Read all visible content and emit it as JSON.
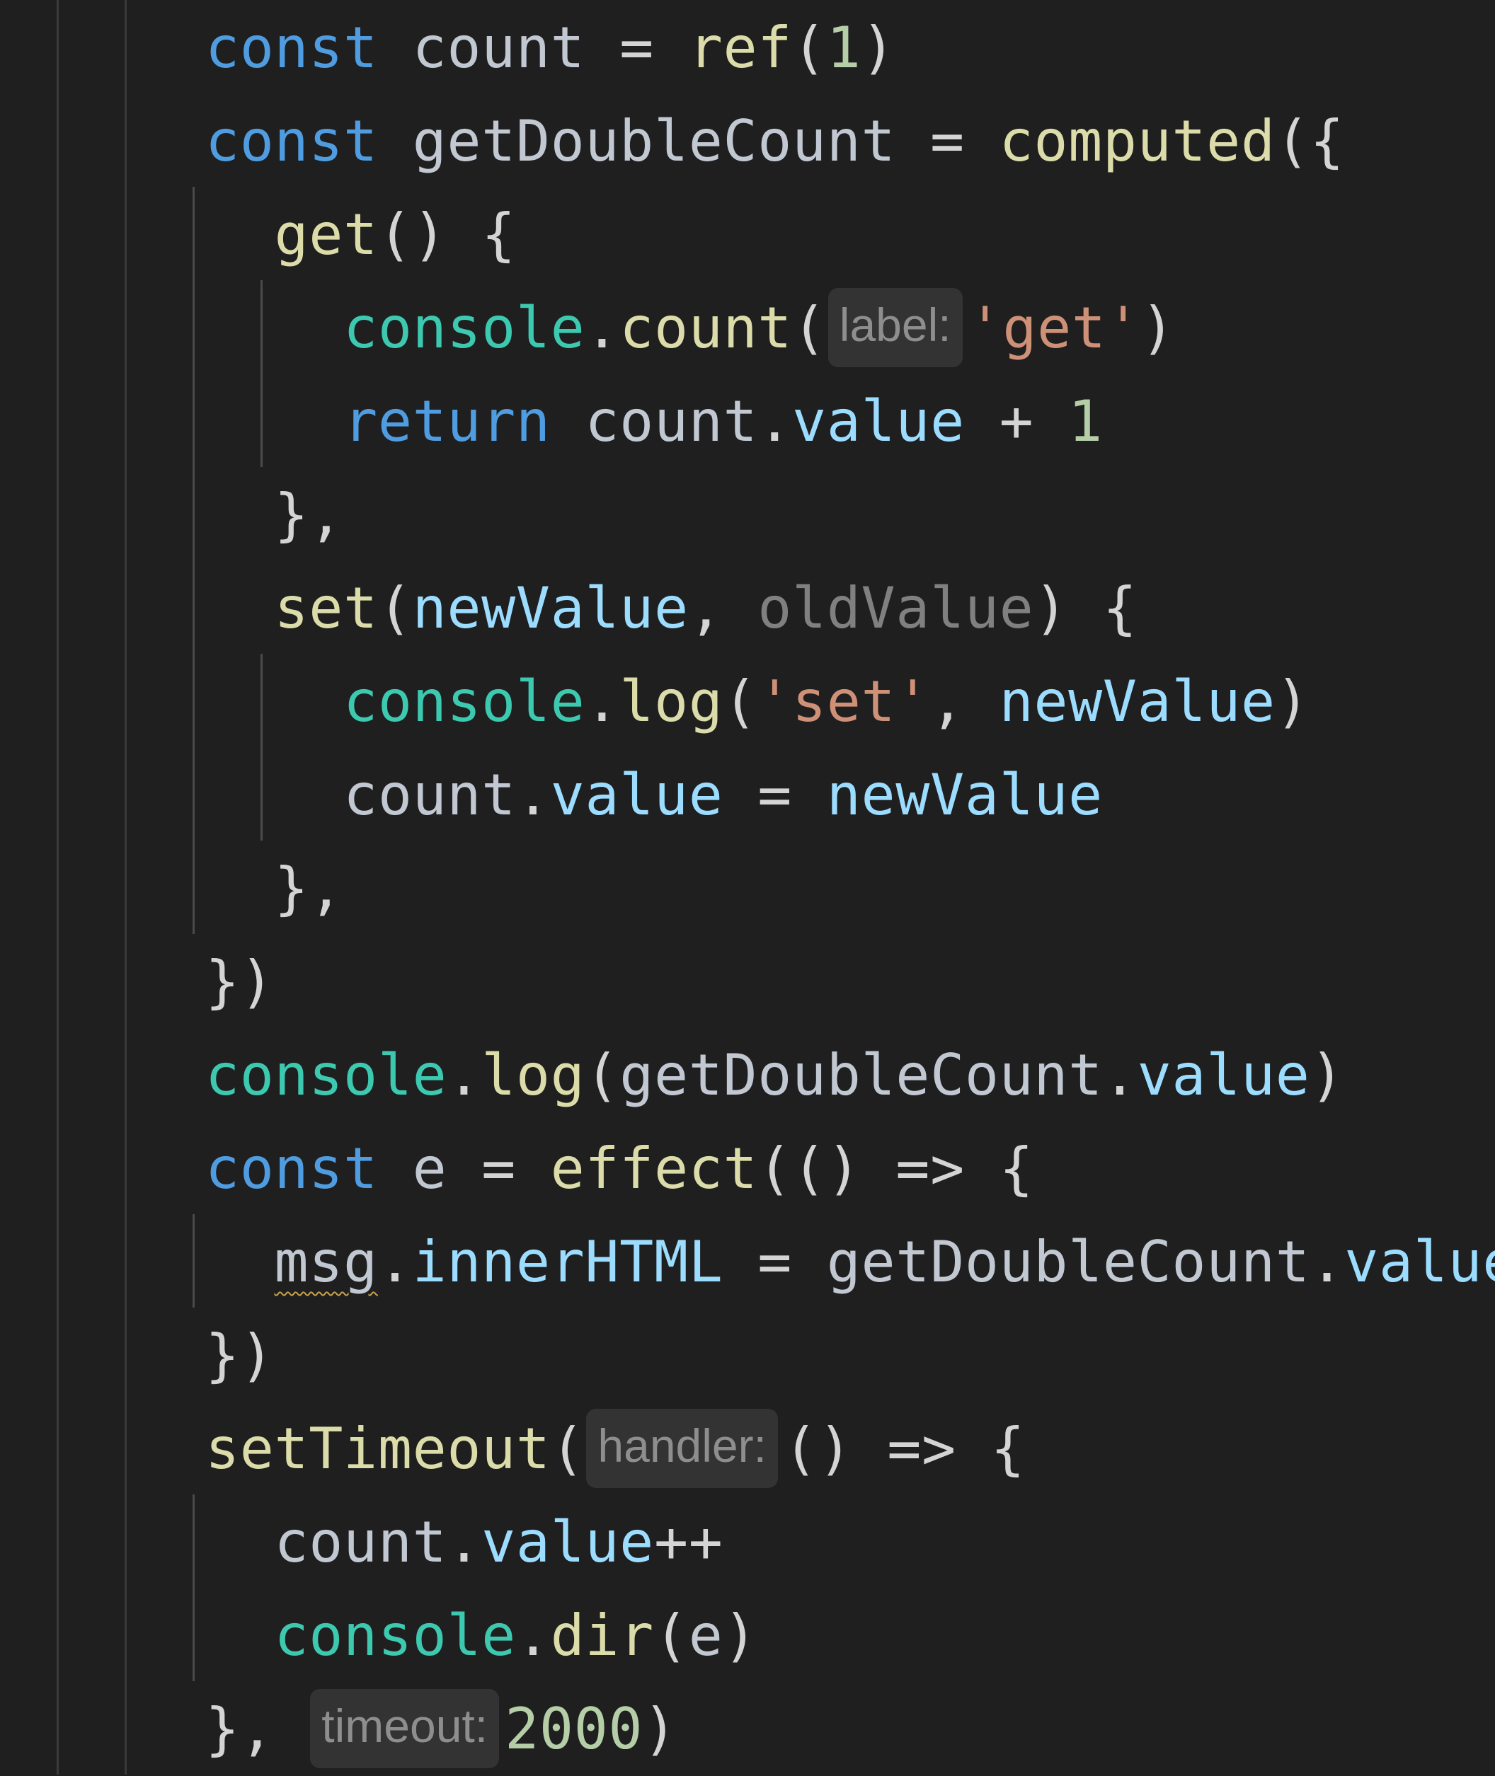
{
  "editor": {
    "language": "javascript",
    "theme_colors": {
      "background": "#1f1f1f",
      "keyword": "#4f9de0",
      "variable": "#c2c8d2",
      "function": "#dcdcaa",
      "class": "#3dc9b0",
      "property": "#9cdcfe",
      "number": "#b5cea8",
      "string": "#ce9178",
      "punctuation": "#d4d4d4",
      "unused": "#808080",
      "inlay_hint_bg": "#333333",
      "inlay_hint_fg": "#8e8e8e"
    },
    "lines": [
      {
        "tokens": [
          {
            "t": "kw",
            "v": "const"
          },
          {
            "t": "pun",
            "v": " "
          },
          {
            "t": "var",
            "v": "count"
          },
          {
            "t": "op",
            "v": " = "
          },
          {
            "t": "fn",
            "v": "ref"
          },
          {
            "t": "pun",
            "v": "("
          },
          {
            "t": "num",
            "v": "1"
          },
          {
            "t": "pun",
            "v": ")"
          }
        ]
      },
      {
        "tokens": [
          {
            "t": "kw",
            "v": "const"
          },
          {
            "t": "pun",
            "v": " "
          },
          {
            "t": "var",
            "v": "getDoubleCount"
          },
          {
            "t": "op",
            "v": " = "
          },
          {
            "t": "fn",
            "v": "computed"
          },
          {
            "t": "pun",
            "v": "({"
          }
        ]
      },
      {
        "tokens": [
          {
            "t": "pun",
            "v": "  "
          },
          {
            "t": "fn",
            "v": "get"
          },
          {
            "t": "pun",
            "v": "() {"
          }
        ]
      },
      {
        "tokens": [
          {
            "t": "pun",
            "v": "    "
          },
          {
            "t": "cls",
            "v": "console"
          },
          {
            "t": "pun",
            "v": "."
          },
          {
            "t": "fn",
            "v": "count"
          },
          {
            "t": "pun",
            "v": "("
          },
          {
            "t": "hint",
            "v": "label:"
          },
          {
            "t": "str",
            "v": "'get'"
          },
          {
            "t": "pun",
            "v": ")"
          }
        ]
      },
      {
        "tokens": [
          {
            "t": "pun",
            "v": "    "
          },
          {
            "t": "kw",
            "v": "return"
          },
          {
            "t": "pun",
            "v": " "
          },
          {
            "t": "var",
            "v": "count"
          },
          {
            "t": "pun",
            "v": "."
          },
          {
            "t": "prop",
            "v": "value"
          },
          {
            "t": "op",
            "v": " + "
          },
          {
            "t": "num",
            "v": "1"
          }
        ]
      },
      {
        "tokens": [
          {
            "t": "pun",
            "v": "  },"
          }
        ]
      },
      {
        "tokens": [
          {
            "t": "pun",
            "v": "  "
          },
          {
            "t": "fn",
            "v": "set"
          },
          {
            "t": "pun",
            "v": "("
          },
          {
            "t": "prop",
            "v": "newValue"
          },
          {
            "t": "pun",
            "v": ", "
          },
          {
            "t": "unused",
            "v": "oldValue"
          },
          {
            "t": "pun",
            "v": ") {"
          }
        ]
      },
      {
        "tokens": [
          {
            "t": "pun",
            "v": "    "
          },
          {
            "t": "cls",
            "v": "console"
          },
          {
            "t": "pun",
            "v": "."
          },
          {
            "t": "fn",
            "v": "log"
          },
          {
            "t": "pun",
            "v": "("
          },
          {
            "t": "str",
            "v": "'set'"
          },
          {
            "t": "pun",
            "v": ", "
          },
          {
            "t": "prop",
            "v": "newValue"
          },
          {
            "t": "pun",
            "v": ")"
          }
        ]
      },
      {
        "tokens": [
          {
            "t": "pun",
            "v": "    "
          },
          {
            "t": "var",
            "v": "count"
          },
          {
            "t": "pun",
            "v": "."
          },
          {
            "t": "prop",
            "v": "value"
          },
          {
            "t": "op",
            "v": " = "
          },
          {
            "t": "prop",
            "v": "newValue"
          }
        ]
      },
      {
        "tokens": [
          {
            "t": "pun",
            "v": "  },"
          }
        ]
      },
      {
        "tokens": [
          {
            "t": "pun",
            "v": "})"
          }
        ]
      },
      {
        "tokens": [
          {
            "t": "cls",
            "v": "console"
          },
          {
            "t": "pun",
            "v": "."
          },
          {
            "t": "fn",
            "v": "log"
          },
          {
            "t": "pun",
            "v": "("
          },
          {
            "t": "var",
            "v": "getDoubleCount"
          },
          {
            "t": "pun",
            "v": "."
          },
          {
            "t": "prop",
            "v": "value"
          },
          {
            "t": "pun",
            "v": ")"
          }
        ]
      },
      {
        "tokens": [
          {
            "t": "kw",
            "v": "const"
          },
          {
            "t": "pun",
            "v": " "
          },
          {
            "t": "var",
            "v": "e"
          },
          {
            "t": "op",
            "v": " = "
          },
          {
            "t": "fn",
            "v": "effect"
          },
          {
            "t": "pun",
            "v": "(() => {"
          }
        ]
      },
      {
        "tokens": [
          {
            "t": "pun",
            "v": "  "
          },
          {
            "t": "squiggle",
            "v": "msg"
          },
          {
            "t": "pun",
            "v": "."
          },
          {
            "t": "prop",
            "v": "innerHTML"
          },
          {
            "t": "op",
            "v": " = "
          },
          {
            "t": "var",
            "v": "getDoubleCount"
          },
          {
            "t": "pun",
            "v": "."
          },
          {
            "t": "prop",
            "v": "value"
          }
        ]
      },
      {
        "tokens": [
          {
            "t": "pun",
            "v": "})"
          }
        ]
      },
      {
        "tokens": [
          {
            "t": "fn",
            "v": "setTimeout"
          },
          {
            "t": "pun",
            "v": "("
          },
          {
            "t": "hint",
            "v": "handler:"
          },
          {
            "t": "pun",
            "v": "() => {"
          }
        ]
      },
      {
        "tokens": [
          {
            "t": "pun",
            "v": "  "
          },
          {
            "t": "var",
            "v": "count"
          },
          {
            "t": "pun",
            "v": "."
          },
          {
            "t": "prop",
            "v": "value"
          },
          {
            "t": "op",
            "v": "++"
          }
        ]
      },
      {
        "tokens": [
          {
            "t": "pun",
            "v": "  "
          },
          {
            "t": "cls",
            "v": "console"
          },
          {
            "t": "pun",
            "v": "."
          },
          {
            "t": "fn",
            "v": "dir"
          },
          {
            "t": "pun",
            "v": "("
          },
          {
            "t": "var",
            "v": "e"
          },
          {
            "t": "pun",
            "v": ")"
          }
        ]
      },
      {
        "tokens": [
          {
            "t": "pun",
            "v": "}, "
          },
          {
            "t": "hint",
            "v": "timeout:"
          },
          {
            "t": "num",
            "v": "2000"
          },
          {
            "t": "pun",
            "v": ")"
          }
        ]
      }
    ]
  }
}
